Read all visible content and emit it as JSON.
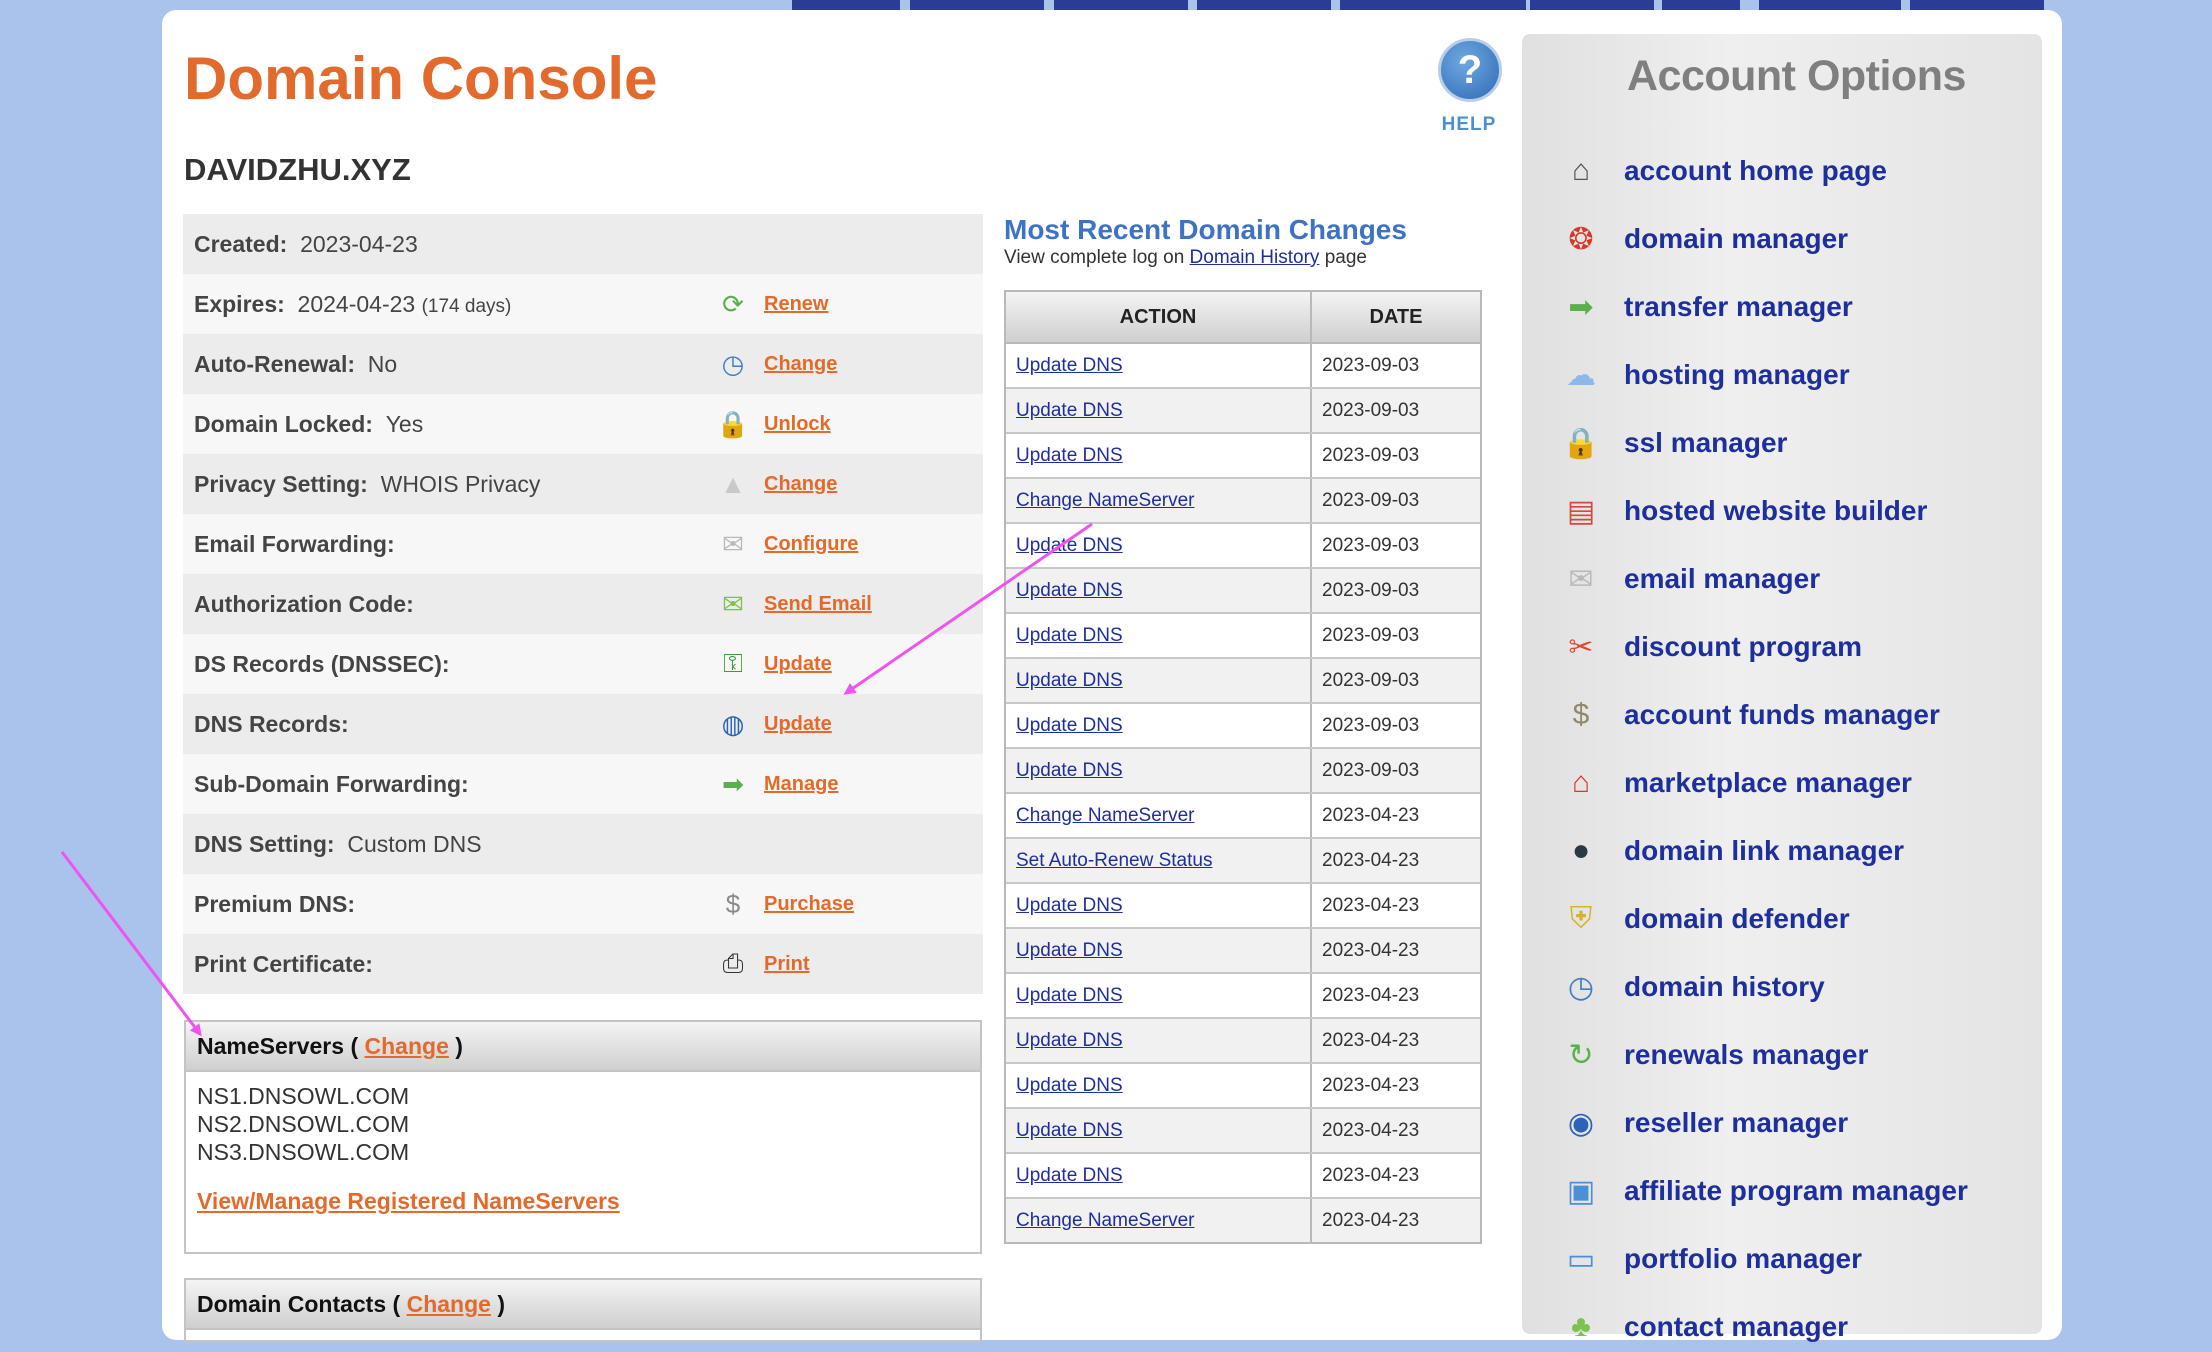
{
  "page": {
    "title": "Domain Console",
    "domain": "DAVIDZHU.XYZ",
    "help_label": "HELP",
    "help_glyph": "?"
  },
  "info_rows": [
    {
      "label": "Created:",
      "value": "2023-04-23",
      "sub": "",
      "icon": "",
      "link": ""
    },
    {
      "label": "Expires:",
      "value": "2024-04-23",
      "sub": "(174 days)",
      "icon": "renew-icon",
      "link": "Renew"
    },
    {
      "label": "Auto-Renewal:",
      "value": "No",
      "sub": "",
      "icon": "clock-icon",
      "link": "Change"
    },
    {
      "label": "Domain Locked:",
      "value": "Yes",
      "sub": "",
      "icon": "padlock-icon",
      "link": "Unlock"
    },
    {
      "label": "Privacy Setting:",
      "value": "WHOIS Privacy",
      "sub": "",
      "icon": "privacy-icon",
      "link": "Change"
    },
    {
      "label": "Email Forwarding:",
      "value": "",
      "sub": "",
      "icon": "envelope-icon",
      "link": "Configure"
    },
    {
      "label": "Authorization Code:",
      "value": "",
      "sub": "",
      "icon": "send-email-icon",
      "link": "Send Email"
    },
    {
      "label": "DS Records (DNSSEC):",
      "value": "",
      "sub": "",
      "icon": "key-icon",
      "link": "Update"
    },
    {
      "label": "DNS Records:",
      "value": "",
      "sub": "",
      "icon": "globe-icon",
      "link": "Update"
    },
    {
      "label": "Sub-Domain Forwarding:",
      "value": "",
      "sub": "",
      "icon": "arrow-right-icon",
      "link": "Manage"
    },
    {
      "label": "DNS Setting:",
      "value": "Custom DNS",
      "sub": "",
      "icon": "",
      "link": ""
    },
    {
      "label": "Premium DNS:",
      "value": "",
      "sub": "",
      "icon": "dollar-icon",
      "link": "Purchase"
    },
    {
      "label": "Print Certificate:",
      "value": "",
      "sub": "",
      "icon": "printer-icon",
      "link": "Print"
    }
  ],
  "nameservers": {
    "title": "NameServers",
    "open": "(",
    "close": ")",
    "change_label": "Change",
    "items": [
      "NS1.DNSOWL.COM",
      "NS2.DNSOWL.COM",
      "NS3.DNSOWL.COM"
    ],
    "manage_label": "View/Manage Registered NameServers"
  },
  "contacts": {
    "title": "Domain Contacts",
    "open": "(",
    "close": ")",
    "change_label": "Change"
  },
  "recent_changes": {
    "title": "Most Recent Domain Changes",
    "sub_prefix": "View complete log on",
    "sub_link": "Domain History",
    "sub_suffix": "page",
    "headers": [
      "ACTION",
      "DATE"
    ],
    "rows": [
      {
        "action": "Update DNS",
        "date": "2023-09-03"
      },
      {
        "action": "Update DNS",
        "date": "2023-09-03"
      },
      {
        "action": "Update DNS",
        "date": "2023-09-03"
      },
      {
        "action": "Change NameServer",
        "date": "2023-09-03"
      },
      {
        "action": "Update DNS",
        "date": "2023-09-03"
      },
      {
        "action": "Update DNS",
        "date": "2023-09-03"
      },
      {
        "action": "Update DNS",
        "date": "2023-09-03"
      },
      {
        "action": "Update DNS",
        "date": "2023-09-03"
      },
      {
        "action": "Update DNS",
        "date": "2023-09-03"
      },
      {
        "action": "Update DNS",
        "date": "2023-09-03"
      },
      {
        "action": "Change NameServer",
        "date": "2023-04-23"
      },
      {
        "action": "Set Auto-Renew Status",
        "date": "2023-04-23"
      },
      {
        "action": "Update DNS",
        "date": "2023-04-23"
      },
      {
        "action": "Update DNS",
        "date": "2023-04-23"
      },
      {
        "action": "Update DNS",
        "date": "2023-04-23"
      },
      {
        "action": "Update DNS",
        "date": "2023-04-23"
      },
      {
        "action": "Update DNS",
        "date": "2023-04-23"
      },
      {
        "action": "Update DNS",
        "date": "2023-04-23"
      },
      {
        "action": "Update DNS",
        "date": "2023-04-23"
      },
      {
        "action": "Change NameServer",
        "date": "2023-04-23"
      }
    ]
  },
  "sidebar": {
    "title": "Account Options",
    "items": [
      {
        "label": "account home page",
        "icon": "house-icon"
      },
      {
        "label": "domain manager",
        "icon": "domain-balls-icon"
      },
      {
        "label": "transfer manager",
        "icon": "green-arrow-icon"
      },
      {
        "label": "hosting manager",
        "icon": "cloud-icon"
      },
      {
        "label": "ssl manager",
        "icon": "padlock-icon"
      },
      {
        "label": "hosted website builder",
        "icon": "website-builder-icon"
      },
      {
        "label": "email manager",
        "icon": "envelope-icon"
      },
      {
        "label": "discount program",
        "icon": "discount-tag-icon"
      },
      {
        "label": "account funds manager",
        "icon": "money-bag-icon"
      },
      {
        "label": "marketplace manager",
        "icon": "storefront-icon"
      },
      {
        "label": "domain link manager",
        "icon": "dark-globe-icon"
      },
      {
        "label": "domain defender",
        "icon": "shield-icon"
      },
      {
        "label": "domain history",
        "icon": "clock-icon"
      },
      {
        "label": "renewals manager",
        "icon": "renew-arrow-icon"
      },
      {
        "label": "reseller manager",
        "icon": "blue-globe-icon"
      },
      {
        "label": "affiliate program manager",
        "icon": "monitor-icon"
      },
      {
        "label": "portfolio manager",
        "icon": "folder-icon"
      },
      {
        "label": "contact manager",
        "icon": "contacts-icon"
      }
    ]
  },
  "colors": {
    "accent": "#e26a2c",
    "link_blue": "#1d2f9c",
    "heading_blue": "#3d73c4",
    "annotation": "#ee55ee"
  }
}
